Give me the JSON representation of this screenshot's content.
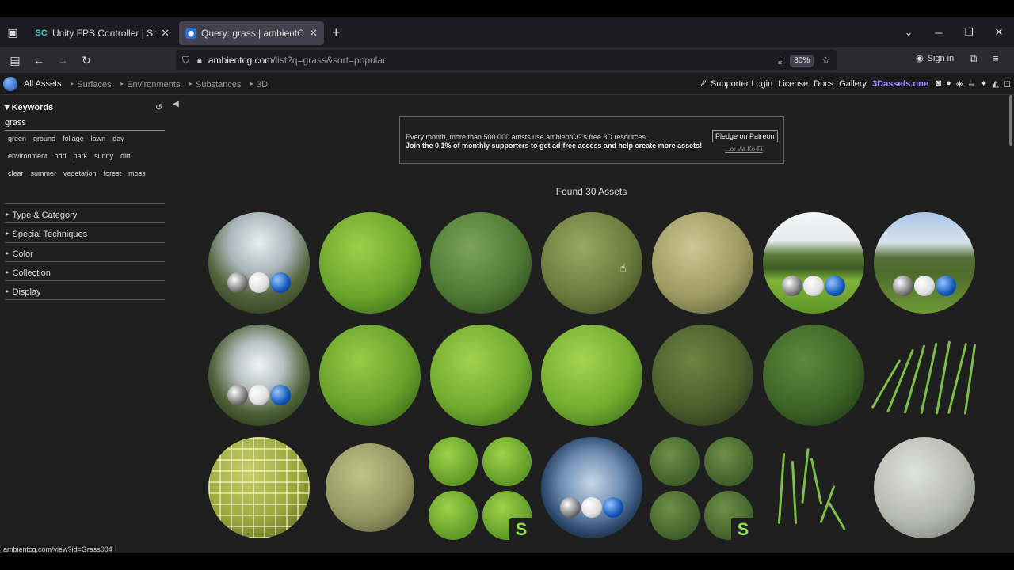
{
  "browser": {
    "tabs": [
      {
        "favicon": "SC",
        "title": "Unity FPS Controller | Sharp Co",
        "active": false
      },
      {
        "favicon": "acg",
        "title": "Query: grass | ambientCG",
        "active": true
      }
    ],
    "url_host": "ambientcg.com",
    "url_path": "/list?q=grass&sort=popular",
    "zoom": "80%",
    "signin": "Sign in"
  },
  "site": {
    "breadcrumbs": [
      "All Assets",
      "Surfaces",
      "Environments",
      "Substances",
      "3D"
    ],
    "links": [
      "Supporter Login",
      "License",
      "Docs",
      "Gallery"
    ],
    "brand": "3Dassets.one"
  },
  "sidebar": {
    "keywords_label": "Keywords",
    "query": "grass",
    "tags": [
      "green",
      "ground",
      "foliage",
      "lawn",
      "day",
      "environment",
      "hdri",
      "park",
      "sunny",
      "dirt",
      "clear",
      "summer",
      "vegetation",
      "forest",
      "moss"
    ],
    "sections": [
      "Type & Category",
      "Special Techniques",
      "Color",
      "Collection",
      "Display"
    ]
  },
  "banner": {
    "line1": "Every month, more than 500,000 artists use ambientCG's free 3D resources.",
    "line2": "Join the 0.1% of monthly supporters to get ad-free access and help create more assets!",
    "pledge": "Pledge on Patreon",
    "kofi": "...or via Ko-Fi"
  },
  "results": {
    "found": "Found 30 Assets"
  },
  "status_url": "ambientcg.com/view?id=Grass004"
}
